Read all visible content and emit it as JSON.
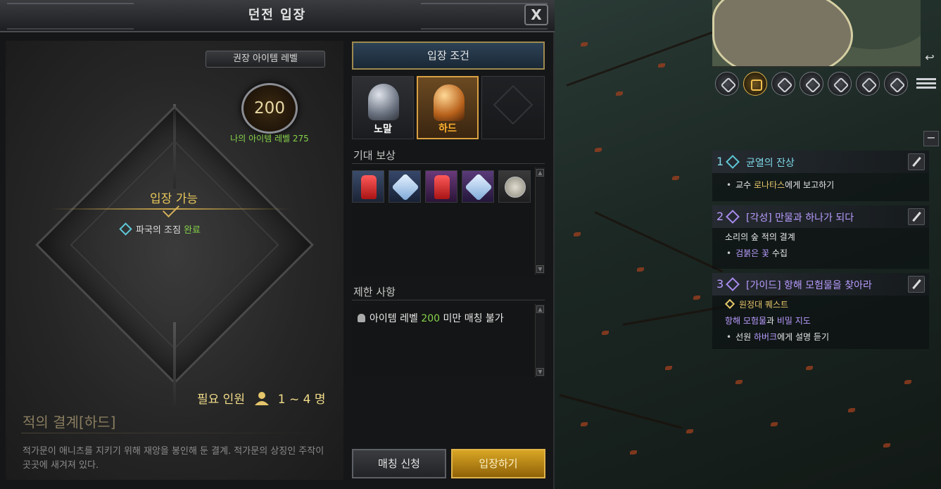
{
  "dialog": {
    "title": "던전 입장",
    "close_label": "X"
  },
  "left_panel": {
    "required_level_label": "권장 아이템 레벨",
    "required_level": "200",
    "my_level_label": "나의 아이템 레벨 275",
    "status": "입장 가능",
    "quest_requirement": "파국의 조짐",
    "quest_requirement_status": "완료",
    "party_label": "필요 인원",
    "party_range": "1 ~ 4 명",
    "dungeon_name": "적의 결계",
    "dungeon_difficulty": "[하드]",
    "description": "적가문이 애니츠를 지키기 위해 재앙을 봉인해 둔 결계. 적가문의 상징인 주작이 곳곳에 새겨져 있다."
  },
  "right_panel": {
    "conditions_button": "입장 조건",
    "difficulties": [
      {
        "label": "노말",
        "selected": false
      },
      {
        "label": "하드",
        "selected": true
      },
      {
        "label": "",
        "locked": true
      }
    ],
    "rewards_title": "기대 보상",
    "rewards": [
      "armor-red-icon",
      "gem-blue-icon",
      "armor-red-icon",
      "gem-purple-icon",
      "coin-silver-icon"
    ],
    "limits_title": "제한 사항",
    "limit_prefix": "아이템 레벨",
    "limit_level": "200",
    "limit_suffix": "미만 매칭 불가",
    "match_button": "매칭 신청",
    "enter_button": "입장하기"
  },
  "toolbar": {
    "icons": [
      "map-search-icon",
      "gift-icon",
      "compass-icon",
      "guild-icon",
      "party-search-icon",
      "camera-icon",
      "cake-icon"
    ],
    "menu_icon": "menu-icon"
  },
  "quests": [
    {
      "num": "1",
      "title": "균열의 잔상",
      "color": "cyan",
      "lines": [
        {
          "bullet": "•",
          "pre": "교수 ",
          "highlight": "로나타스",
          "post": "에게 보고하기"
        }
      ]
    },
    {
      "num": "2",
      "title": "[각성] 만물과 하나가 되다",
      "color": "purple",
      "lines": [
        {
          "plain": "소리의 숲 적의 결계"
        },
        {
          "bullet": "•",
          "highlight": "검붉은 꽃",
          "post": " 수집"
        }
      ]
    },
    {
      "num": "3",
      "title": "[가이드] 항해 모험물을 찾아라",
      "color": "purple",
      "sub_label": "원정대 퀘스트",
      "lines": [
        {
          "pl1": "항해 모험물",
          "mid": "과 ",
          "pl2": "비밀 지도"
        },
        {
          "bullet": "•",
          "pre": "선원 ",
          "highlight": "하버크",
          "post": "에게 설명 듣기"
        }
      ]
    }
  ],
  "colors": {
    "accent_gold": "#e0b44a",
    "quest_cyan": "#7fd9e8",
    "quest_purple": "#b99cff",
    "success_green": "#86d24a"
  }
}
